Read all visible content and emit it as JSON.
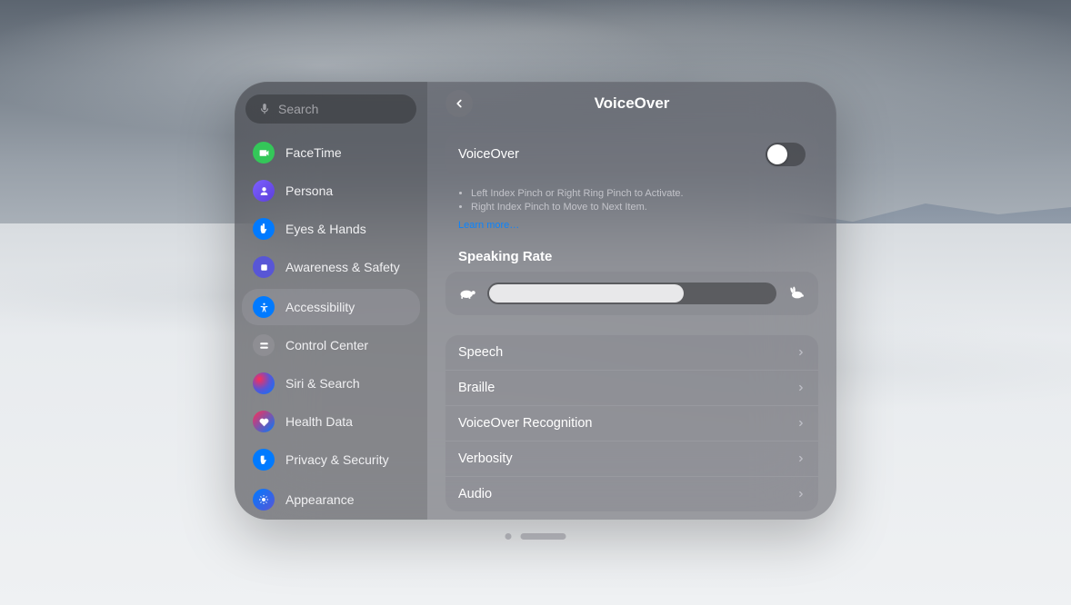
{
  "search": {
    "placeholder": "Search"
  },
  "sidebar": {
    "items": [
      {
        "label": "FaceTime",
        "icon": "facetime"
      },
      {
        "label": "Persona",
        "icon": "persona"
      },
      {
        "label": "Eyes & Hands",
        "icon": "eyeshands"
      },
      {
        "label": "Awareness & Safety",
        "icon": "awareness"
      },
      {
        "label": "Accessibility",
        "icon": "accessibility",
        "selected": true
      },
      {
        "label": "Control Center",
        "icon": "controlcenter"
      },
      {
        "label": "Siri & Search",
        "icon": "siri"
      },
      {
        "label": "Health Data",
        "icon": "health"
      },
      {
        "label": "Privacy & Security",
        "icon": "privacy"
      },
      {
        "label": "Appearance",
        "icon": "appearance"
      }
    ]
  },
  "content": {
    "title": "VoiceOver",
    "toggle": {
      "label": "VoiceOver",
      "on": false
    },
    "hints": [
      "Left Index Pinch or Right Ring Pinch to Activate.",
      "Right Index Pinch to Move to Next Item."
    ],
    "learn_more": "Learn more…",
    "speaking_rate": {
      "title": "Speaking Rate",
      "value": 0.68
    },
    "rows": [
      {
        "label": "Speech"
      },
      {
        "label": "Braille"
      },
      {
        "label": "VoiceOver Recognition"
      },
      {
        "label": "Verbosity"
      },
      {
        "label": "Audio"
      }
    ]
  }
}
